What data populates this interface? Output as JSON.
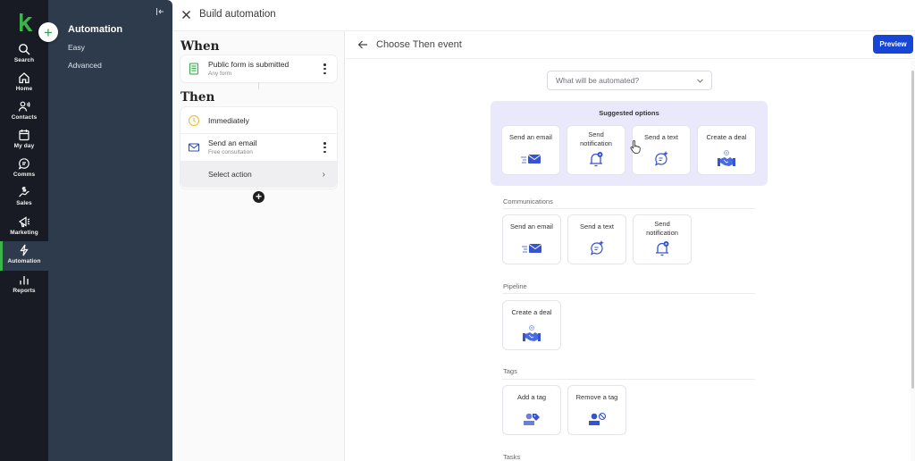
{
  "rail": {
    "items": [
      {
        "label": "Search",
        "icon": "search-icon"
      },
      {
        "label": "Home",
        "icon": "home-icon"
      },
      {
        "label": "Contacts",
        "icon": "contacts-icon"
      },
      {
        "label": "My day",
        "icon": "calendar-icon"
      },
      {
        "label": "Comms",
        "icon": "chat-icon"
      },
      {
        "label": "Sales",
        "icon": "sales-icon"
      },
      {
        "label": "Marketing",
        "icon": "megaphone-icon"
      },
      {
        "label": "Automation",
        "icon": "lightning-icon",
        "active": true
      },
      {
        "label": "Reports",
        "icon": "bar-chart-icon"
      }
    ],
    "brand_color": "#3bb54a"
  },
  "subnav": {
    "title": "Automation",
    "links": [
      "Easy",
      "Advanced"
    ]
  },
  "builder": {
    "title": "Build automation",
    "when_heading": "When",
    "then_heading": "Then",
    "trigger": {
      "title": "Public form is submitted",
      "subtitle": "Any form"
    },
    "timing": "Immediately",
    "action": {
      "title": "Send an email",
      "subtitle": "Free consultation"
    },
    "select_action": "Select action"
  },
  "panel": {
    "title": "Choose Then event",
    "preview_label": "Preview",
    "dropdown_placeholder": "What will be automated?",
    "suggested_title": "Suggested options",
    "suggested": [
      "Send an email",
      "Send notification",
      "Send a text",
      "Create a deal"
    ],
    "sections": [
      {
        "label": "Communications",
        "options": [
          "Send an email",
          "Send a text",
          "Send notification"
        ]
      },
      {
        "label": "Pipeline",
        "options": [
          "Create a deal"
        ]
      },
      {
        "label": "Tags",
        "options": [
          "Add a tag",
          "Remove a tag"
        ]
      },
      {
        "label": "Tasks",
        "options": []
      }
    ],
    "accent_color": "#1745d6"
  }
}
